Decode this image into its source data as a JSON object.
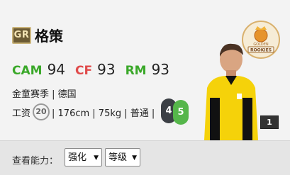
{
  "player": {
    "badge": "GR",
    "name": "格策",
    "positions": [
      {
        "label": "CAM",
        "value": "94",
        "color": "#3aa829"
      },
      {
        "label": "CF",
        "value": "93",
        "color": "#e04b4b"
      },
      {
        "label": "RM",
        "value": "93",
        "color": "#3aa829"
      }
    ],
    "season_nation": "金童赛季 | 德国",
    "salary_label": "工资",
    "salary_value": "20",
    "details": "| 176cm | 75kg | 普通 |",
    "weak_foot": "4",
    "strong_foot": "5",
    "rank": "1",
    "club_badge_text_top": "GOLDEN",
    "club_badge_text_bottom": "ROOKIES"
  },
  "filter_bar": {
    "label": "查看能力：",
    "enhance_select": "强化",
    "level_select": "等级"
  },
  "icons": {
    "club_badge": "golden-rookies-badge-icon",
    "player_photo": "player-photo",
    "foot_left": "left-foot-icon",
    "foot_right": "right-foot-icon",
    "dropdown": "chevron-down-icon"
  }
}
